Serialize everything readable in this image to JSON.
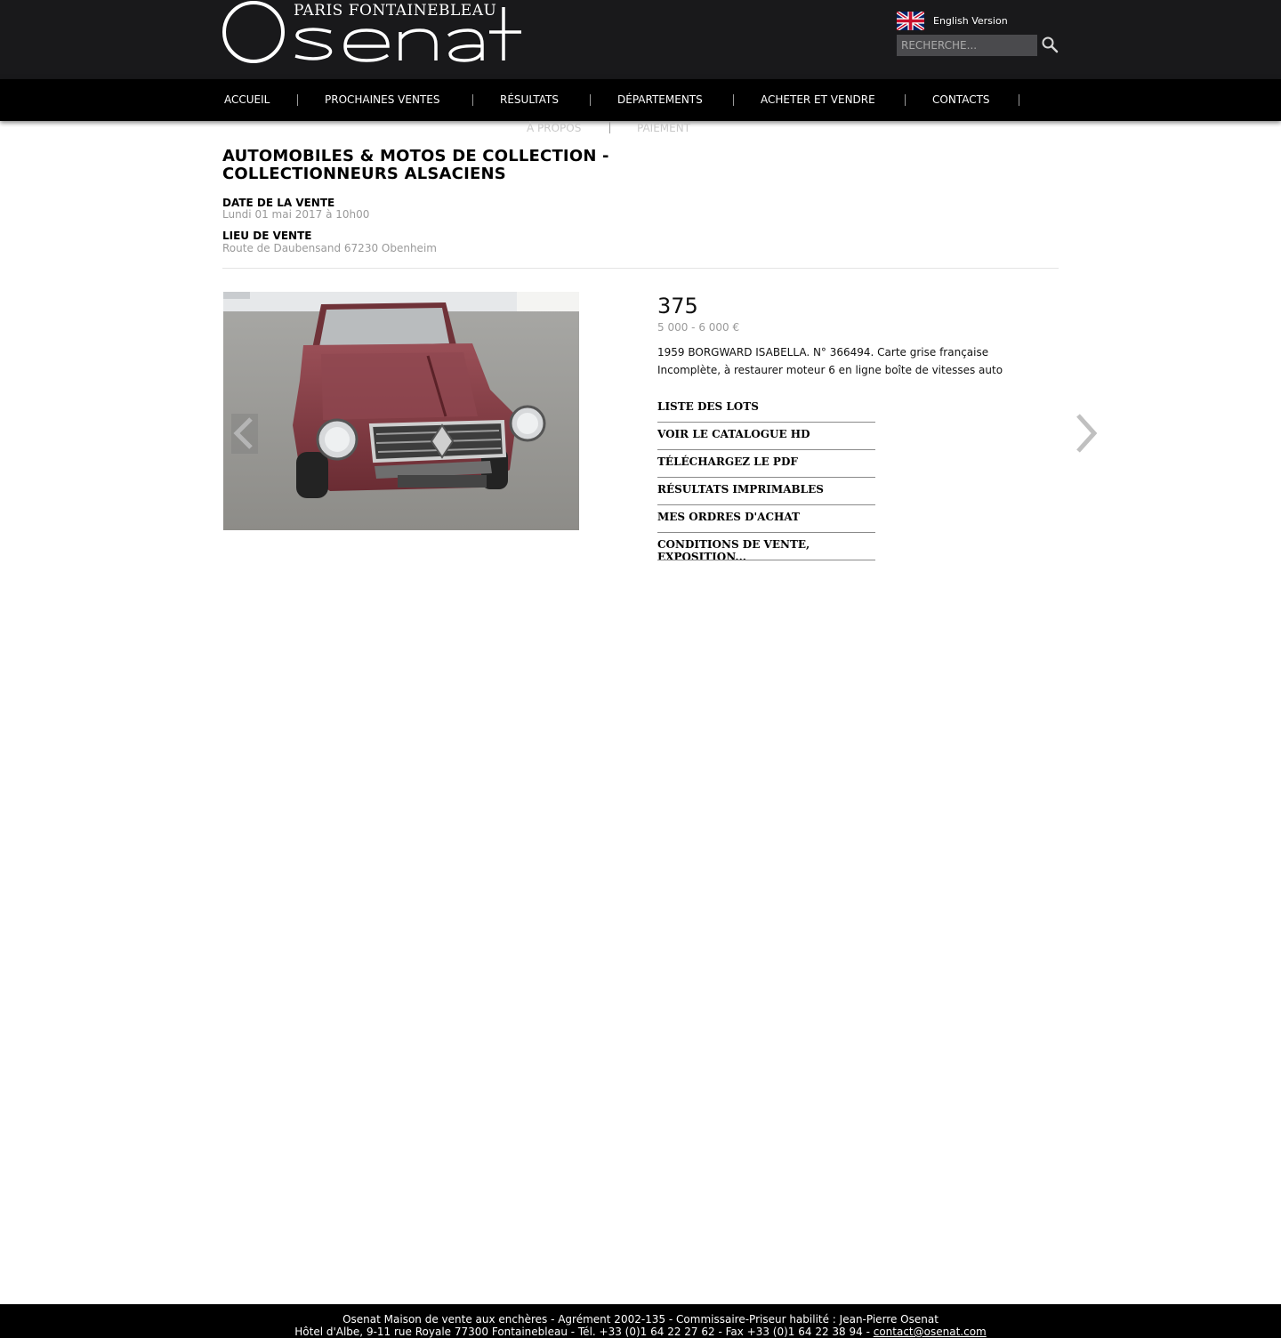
{
  "header": {
    "logo_top": "PARIS FONTAINEBLEAU",
    "logo_name": "Osenat",
    "lang_label": "English Version",
    "search_placeholder": "RECHERCHE..."
  },
  "nav": {
    "items": [
      "ACCUEIL",
      "PROCHAINES VENTES",
      "RÉSULTATS",
      "DÉPARTEMENTS",
      "ACHETER ET VENDRE",
      "CONTACTS",
      "À PROPOS",
      "PAIEMENT"
    ]
  },
  "sale": {
    "title": "AUTOMOBILES & MOTOS DE COLLECTION - COLLECTIONNEURS ALSACIENS",
    "date_label": "DATE DE LA VENTE",
    "date_value": "Lundi 01 mai 2017 à 10h00",
    "place_label": "LIEU DE VENTE",
    "place_value": "Route de Daubensand 67230 Obenheim"
  },
  "lot": {
    "number": "375",
    "estimate": "5 000 - 6 000 €",
    "desc_line1": "1959 BORGWARD ISABELLA. N° 366494. Carte grise française",
    "desc_line2": "Incomplète, à restaurer moteur 6 en ligne boîte de vitesses auto"
  },
  "links": [
    "LISTE DES LOTS",
    "VOIR LE CATALOGUE HD",
    "TÉLÉCHARGEZ LE PDF",
    "RÉSULTATS IMPRIMABLES",
    "MES ORDRES D'ACHAT",
    "CONDITIONS DE VENTE, EXPOSITION..."
  ],
  "footer": {
    "line1": "Osenat Maison de vente aux enchères - Agrément 2002-135 - Commissaire-Priseur habilité : Jean-Pierre Osenat",
    "line2": "Hôtel d'Albe, 9-11 rue Royale 77300 Fontainebleau - Tél. +33 (0)1 64 22 27 62 - Fax +33 (0)1 64 22 38 94 - ",
    "email": "contact@osenat.com"
  },
  "colors": {
    "header_bg": "#19191b",
    "nav_bg": "#000000",
    "muted_text": "#9a9a9a"
  }
}
